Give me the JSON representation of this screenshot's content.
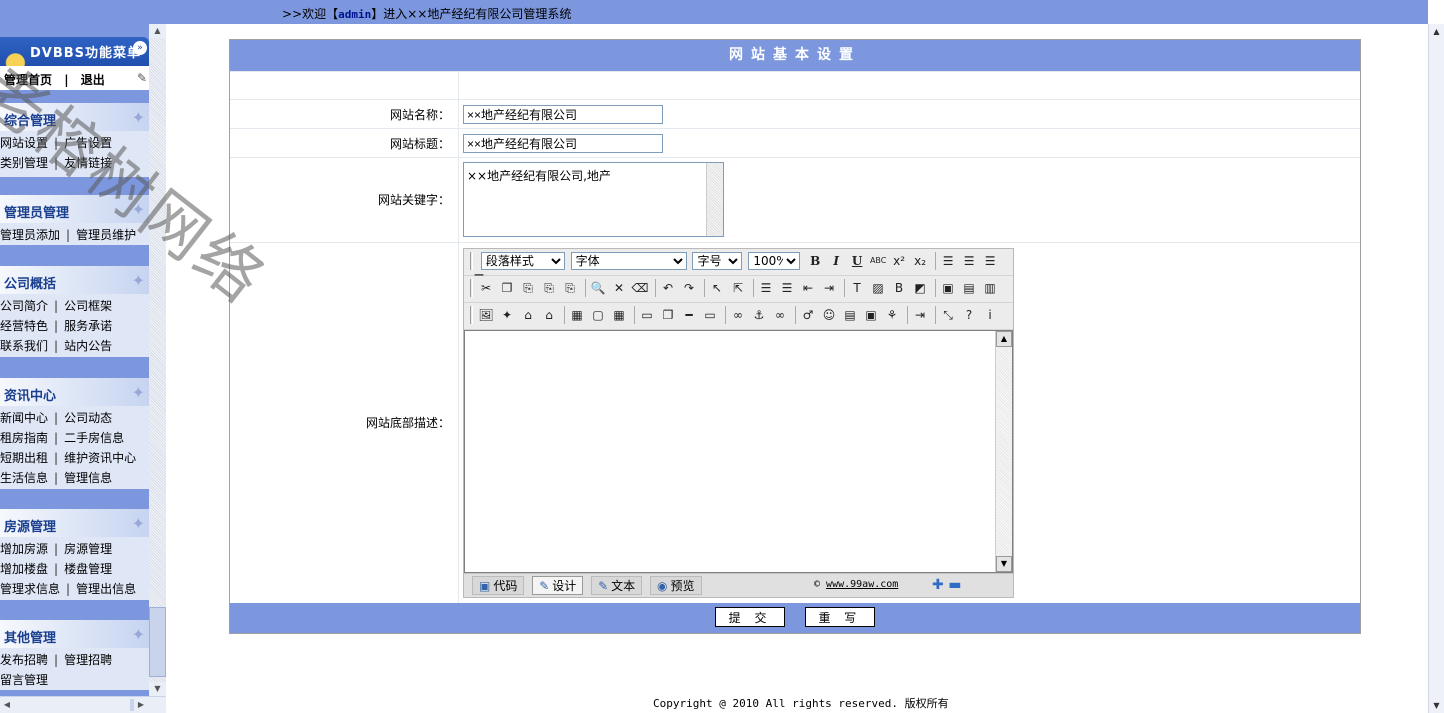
{
  "topbar": {
    "prefix": ">>欢迎【",
    "user": "admin",
    "suffix": "】进入××地产经纪有限公司管理系统"
  },
  "sidebar": {
    "menu_title": "DVBBS功能菜单",
    "home_link": "管理首页",
    "logout_link": "退出",
    "sections": [
      {
        "title": "综合管理",
        "rows": [
          [
            "网站设置",
            "广告设置"
          ],
          [
            "类别管理",
            "友情链接"
          ]
        ]
      },
      {
        "title": "管理员管理",
        "rows": [
          [
            "管理员添加",
            "管理员维护"
          ]
        ]
      },
      {
        "title": "公司概括",
        "rows": [
          [
            "公司简介",
            "公司框架"
          ],
          [
            "经营特色",
            "服务承诺"
          ],
          [
            "联系我们",
            "站内公告"
          ]
        ]
      },
      {
        "title": "资讯中心",
        "rows": [
          [
            "新闻中心",
            "公司动态"
          ],
          [
            "租房指南",
            "二手房信息"
          ],
          [
            "短期出租",
            "维护资讯中心"
          ],
          [
            "生活信息",
            "管理信息"
          ]
        ]
      },
      {
        "title": "房源管理",
        "rows": [
          [
            "增加房源",
            "房源管理"
          ],
          [
            "增加楼盘",
            "楼盘管理"
          ],
          [
            "管理求信息",
            "管理出信息"
          ]
        ]
      },
      {
        "title": "其他管理",
        "rows": [
          [
            "发布招聘",
            "管理招聘"
          ],
          [
            "留言管理",
            ""
          ]
        ]
      }
    ]
  },
  "panel": {
    "title": "网站基本设置",
    "site_name_label": "网站名称：",
    "site_name_value": "××地产经纪有限公司",
    "site_title_label": "网站标题：",
    "site_title_value": "××地产经纪有限公司",
    "keywords_label": "网站关键字：",
    "keywords_value": "××地产经纪有限公司,地产",
    "footer_label": "网站底部描述："
  },
  "editor": {
    "paragraph_select": "段落样式",
    "font_select": "字体",
    "size_select": "字号",
    "zoom_select": "100%",
    "modes": [
      "代码",
      "设计",
      "文本",
      "预览"
    ],
    "credit_prefix": "© ",
    "credit_link": "www.99aw.com"
  },
  "buttons": {
    "submit": "提 交",
    "reset": "重 写"
  },
  "copyright": "Copyright @ 2010 All rights reserved.  版权所有",
  "watermark": "老榕树网络"
}
